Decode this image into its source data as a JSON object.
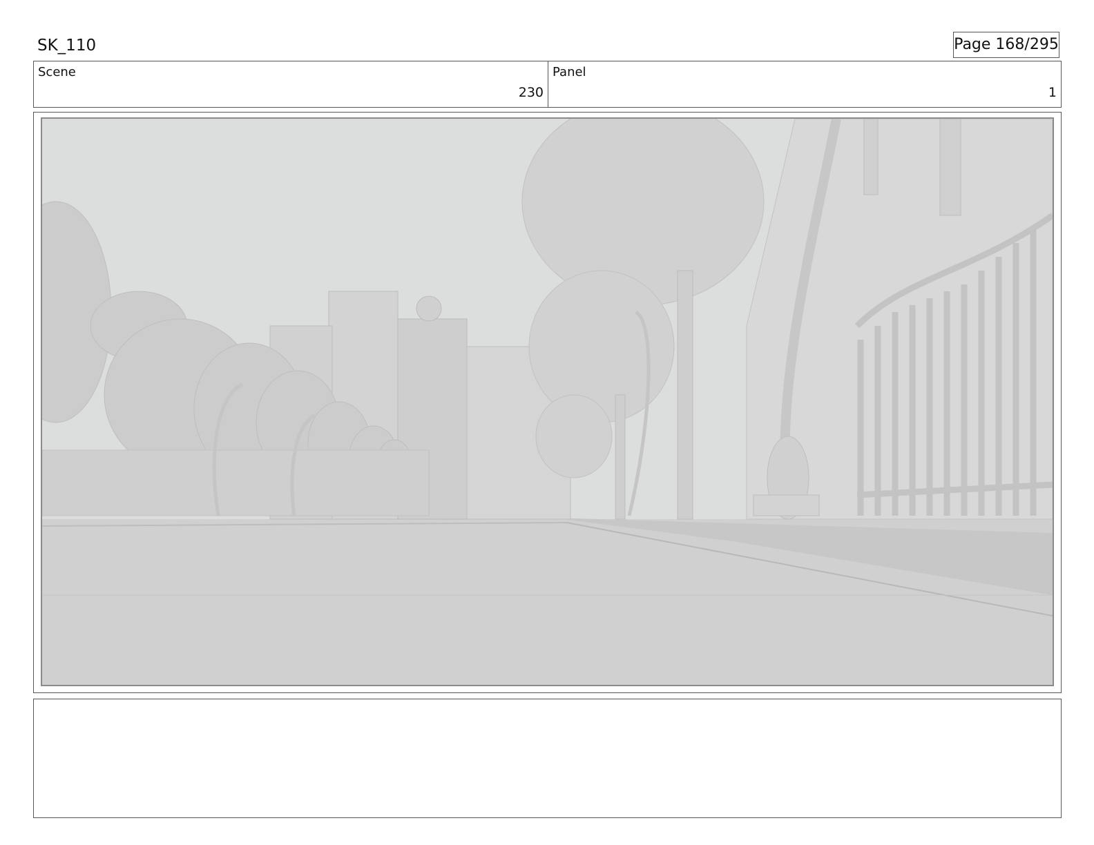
{
  "header": {
    "project": "SK_110",
    "page": "Page 168/295"
  },
  "scene": {
    "label": "Scene",
    "value": "230"
  },
  "panel": {
    "label": "Panel",
    "value": "1"
  },
  "notes": {
    "text": ""
  }
}
